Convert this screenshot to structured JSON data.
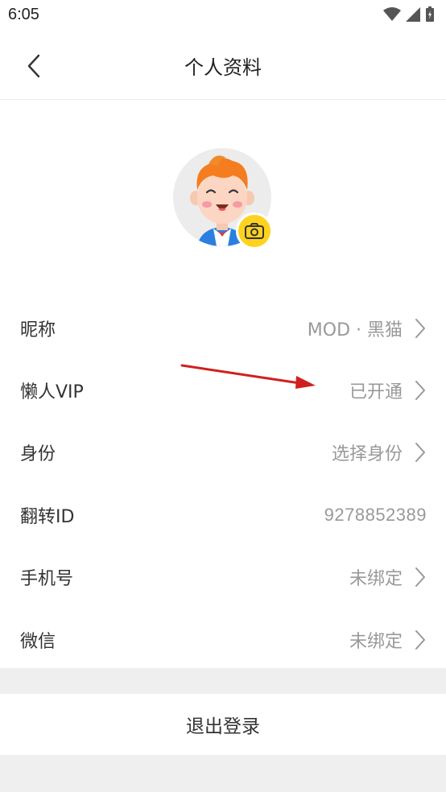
{
  "status_bar": {
    "time": "6:05"
  },
  "header": {
    "title": "个人资料"
  },
  "profile": {
    "avatar_icon": "boy-avatar",
    "camera_icon": "camera-icon",
    "badge_color": "#ffd21f"
  },
  "rows": [
    {
      "label": "昵称",
      "value": "MOD · 黑猫",
      "has_chevron": true
    },
    {
      "label": "懒人VIP",
      "value": "已开通",
      "has_chevron": true
    },
    {
      "label": "身份",
      "value": "选择身份",
      "has_chevron": true
    },
    {
      "label": "翻转ID",
      "value": "9278852389",
      "has_chevron": false
    },
    {
      "label": "手机号",
      "value": "未绑定",
      "has_chevron": true
    },
    {
      "label": "微信",
      "value": "未绑定",
      "has_chevron": true
    }
  ],
  "logout": {
    "label": "退出登录"
  },
  "annotation": {
    "arrow_color": "#d11f1f"
  }
}
